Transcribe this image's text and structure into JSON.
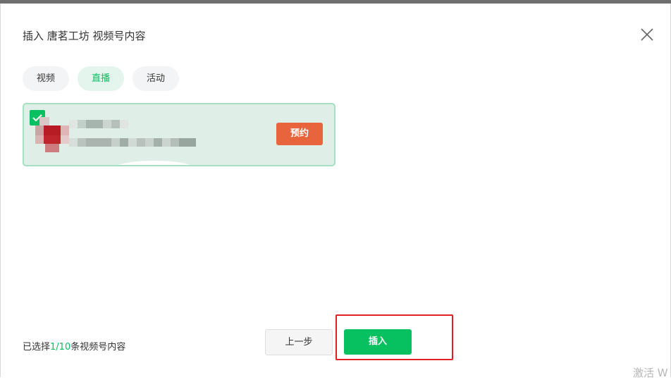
{
  "dialog": {
    "title": "插入 唐茗工坊 视频号内容"
  },
  "tabs": [
    {
      "label": "视频",
      "active": false
    },
    {
      "label": "直播",
      "active": true
    },
    {
      "label": "活动",
      "active": false
    }
  ],
  "live_card": {
    "selected": true,
    "action_label": "预约"
  },
  "footer": {
    "prefix": "已选择",
    "count": "1/10",
    "suffix": "条视频号内容"
  },
  "buttons": {
    "prev_label": "上一步",
    "insert_label": "插入"
  },
  "watermark": "激活 W",
  "colors": {
    "accent": "#07c160",
    "reserve": "#e8643c",
    "highlight": "#e02020",
    "card_bg": "#dfefe8"
  }
}
